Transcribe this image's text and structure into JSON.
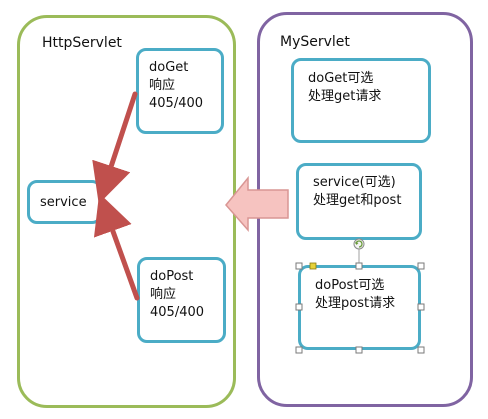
{
  "left_container": {
    "title": "HttpServlet",
    "boxes": {
      "doget": {
        "lines": [
          "doGet",
          "响应",
          "405/400"
        ]
      },
      "service": {
        "lines": [
          "service"
        ]
      },
      "dopost": {
        "lines": [
          "doPost",
          "响应",
          "405/400"
        ]
      }
    }
  },
  "right_container": {
    "title": "MyServlet",
    "boxes": {
      "doget": {
        "lines": [
          "doGet可选",
          "处理get请求"
        ]
      },
      "service": {
        "lines": [
          "service(可选)",
          "处理get和post"
        ]
      },
      "dopost": {
        "lines": [
          "doPost可选",
          "处理post请求"
        ]
      }
    }
  },
  "colors": {
    "http_container_border": "#9bbb59",
    "my_container_border": "#8064a2",
    "box_border": "#4bacc6",
    "red_arrow": "#c0504d",
    "block_arrow_fill": "#f6c3c0",
    "block_arrow_stroke": "#d99694"
  },
  "icons": {
    "selection_rotate_handle": "rotate-icon",
    "selection_handles": "square-handle"
  }
}
